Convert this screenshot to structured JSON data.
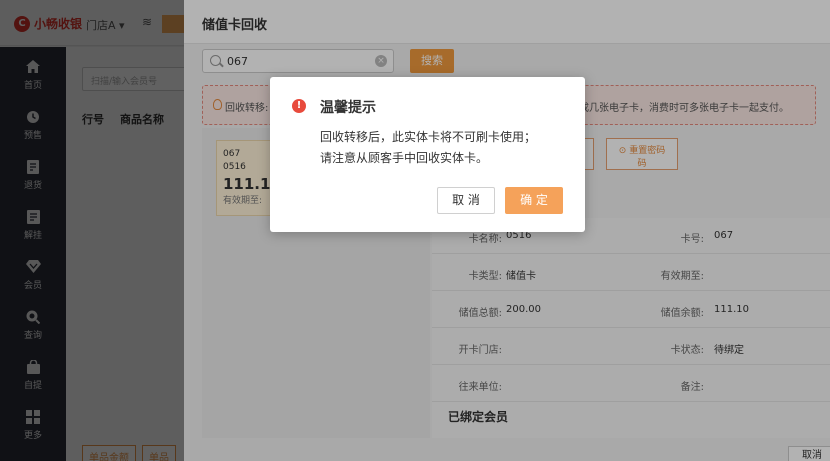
{
  "app": {
    "logo_mark": "C",
    "logo_text": "小畅收银",
    "store": "门店A ▾",
    "wifi": "≋"
  },
  "sidebar": {
    "items": [
      {
        "label": "首页",
        "icon": "home-icon"
      },
      {
        "label": "预售",
        "icon": "clock-icon"
      },
      {
        "label": "退货",
        "icon": "return-icon"
      },
      {
        "label": "解挂",
        "icon": "unhang-icon"
      },
      {
        "label": "会员",
        "icon": "member-icon"
      },
      {
        "label": "查询",
        "icon": "search-icon"
      },
      {
        "label": "自提",
        "icon": "bag-icon"
      },
      {
        "label": "更多",
        "icon": "grid-icon"
      }
    ]
  },
  "main": {
    "scan_placeholder": "扫描/输入会员号",
    "col_row": "行号",
    "col_name": "商品名称",
    "bottom_tabs": [
      "单品金额",
      "单品"
    ]
  },
  "drawer": {
    "title": "储值卡回收",
    "search_value": "067",
    "clear": "×",
    "search_btn": "搜索",
    "notice_left": "回收转移:",
    "notice_right": "生成几张电子卡，消费时可多张电子卡一起支付。",
    "card": {
      "no": "067",
      "sub": "0516",
      "amount": "111.10",
      "expiry": "有效期至:"
    },
    "op_buttons": [
      {
        "icon": "⊙",
        "label": "重置密码",
        "sub": "码"
      }
    ],
    "details": {
      "card_name_k": "卡名称:",
      "card_name_v": "0516",
      "card_no_k": "卡号:",
      "card_no_v": "067",
      "card_type_k": "卡类型:",
      "card_type_v": "储值卡",
      "expiry_k": "有效期至:",
      "expiry_v": "",
      "total_k": "储值总额:",
      "total_v": "200.00",
      "balance_k": "储值余额:",
      "balance_v": "111.10",
      "open_store_k": "开卡门店:",
      "open_store_v": "",
      "status_k": "卡状态:",
      "status_v": "待绑定",
      "unit_k": "往来单位:",
      "unit_v": "",
      "remark_k": "备注:",
      "remark_v": ""
    },
    "bound_title": "已绑定会员",
    "cancel": "取消"
  },
  "modal": {
    "icon": "!",
    "title": "温馨提示",
    "line1": "回收转移后，此实体卡将不可刷卡使用；",
    "line2": "请注意从顾客手中回收实体卡。",
    "cancel": "取 消",
    "ok": "确 定"
  },
  "colors": {
    "accent": "#f5a25a",
    "danger": "#e84a3c",
    "sidebar": "#2b2f3a"
  }
}
